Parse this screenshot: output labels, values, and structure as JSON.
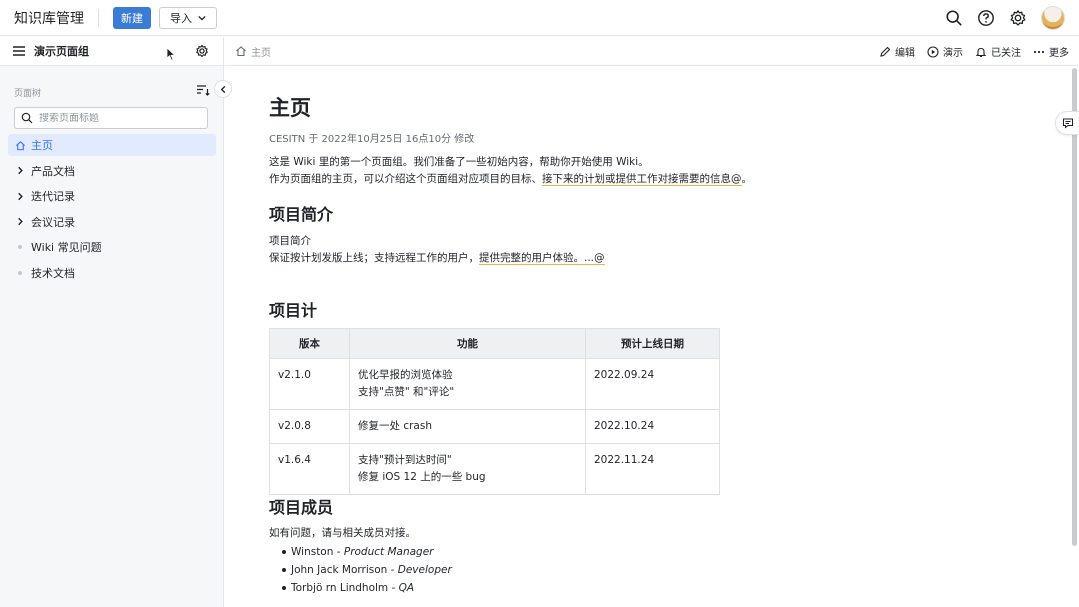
{
  "header": {
    "app_title": "知识库管理",
    "new_label": "新建",
    "import_label": "导入"
  },
  "sidebar": {
    "group_name": "演示页面组",
    "tree_label": "页面树",
    "search_placeholder": "搜索页面标题",
    "items": [
      {
        "label": "主页",
        "type": "home",
        "active": true
      },
      {
        "label": "产品文档",
        "type": "folder"
      },
      {
        "label": "迭代记录",
        "type": "folder"
      },
      {
        "label": "会议记录",
        "type": "folder"
      },
      {
        "label": "Wiki 常见问题",
        "type": "page"
      },
      {
        "label": "技术文档",
        "type": "page"
      }
    ]
  },
  "content_header": {
    "breadcrumb": "主页",
    "actions": {
      "edit": "编辑",
      "present": "演示",
      "followed": "已关注",
      "more": "更多"
    }
  },
  "page": {
    "title": "主页",
    "meta": "CESITN 于 2022年10月25日 16点10分 修改",
    "intro_line1": "这是 Wiki 里的第一个页面组。我们准备了一些初始内容，帮助你开始使用 Wiki。",
    "intro_line2_plain": "作为页面组的主页，可以介绍这个页面组对应项目的目标、",
    "intro_line2_link": "接下来的计划或提供工作对接需要的信息@",
    "intro_line2_end": "。",
    "section1_title": "项目简介",
    "section1_line1": "项目简介",
    "section1_line2_plain": "保证按计划发版上线；支持远程工作的用户，",
    "section1_line2_link": "提供完整的用户体验。...@",
    "section2_title": "项目计",
    "table": {
      "headers": [
        "版本",
        "功能",
        "预计上线日期"
      ],
      "rows": [
        {
          "version": "v2.1.0",
          "feature_line1": "优化早报的浏览体验",
          "feature_line2": "支持\"点赞\" 和\"评论\"",
          "date": "2022.09.24"
        },
        {
          "version": "v2.0.8",
          "feature_line1": "修复一处 crash",
          "feature_line2": "",
          "date": "2022.10.24"
        },
        {
          "version": "v1.6.4",
          "feature_line1": "支持\"预计到达时间\"",
          "feature_line2": "修复 iOS 12 上的一些 bug",
          "date": "2022.11.24"
        }
      ]
    },
    "section3_title": "项目成员",
    "members_intro": "如有问题，请与相关成员对接。",
    "members": [
      {
        "name": "Winston - ",
        "role": "Product Manager"
      },
      {
        "name": "John Jack Morrison - ",
        "role": "Developer"
      },
      {
        "name": "Torbjö rn Lindholm - ",
        "role": "QA"
      }
    ]
  },
  "colors": {
    "primary": "#3a7bd5",
    "active_bg": "#e1eaff",
    "active_text": "#3370ff",
    "link_underline": "#f3b33d"
  }
}
